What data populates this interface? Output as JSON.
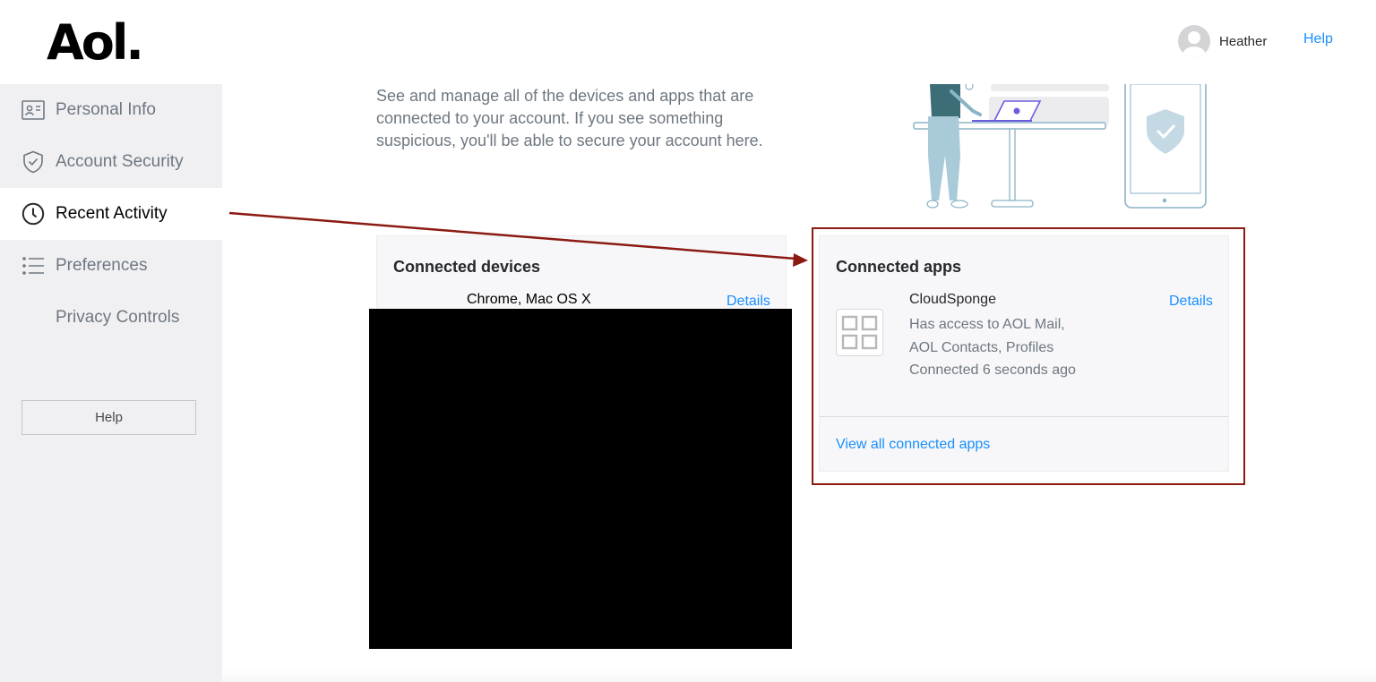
{
  "header": {
    "logo": "Aol.",
    "user_name": "Heather",
    "help_label": "Help"
  },
  "sidebar": {
    "items": [
      {
        "label": "Personal Info",
        "icon": "id-card-icon"
      },
      {
        "label": "Account Security",
        "icon": "shield-icon"
      },
      {
        "label": "Recent Activity",
        "icon": "clock-icon",
        "active": true
      },
      {
        "label": "Preferences",
        "icon": "list-icon"
      },
      {
        "label": "Privacy Controls",
        "icon": null
      }
    ],
    "help_button": "Help"
  },
  "main": {
    "intro": "See and manage all of the devices and apps that are connected to your account. If you see something suspicious, you'll be able to secure your account here.",
    "devices": {
      "title": "Connected devices",
      "first_device": "Chrome, Mac OS X",
      "details_label": "Details"
    },
    "apps": {
      "title": "Connected apps",
      "app_name": "CloudSponge",
      "access_line1": "Has access to AOL Mail,",
      "access_line2": "AOL Contacts, Profiles",
      "connected_time": "Connected 6 seconds ago",
      "details_label": "Details",
      "view_all_label": "View all connected apps"
    }
  },
  "colors": {
    "link": "#188fff",
    "sidebar_bg": "#f0f0f3",
    "annotation": "#8b1a12"
  }
}
